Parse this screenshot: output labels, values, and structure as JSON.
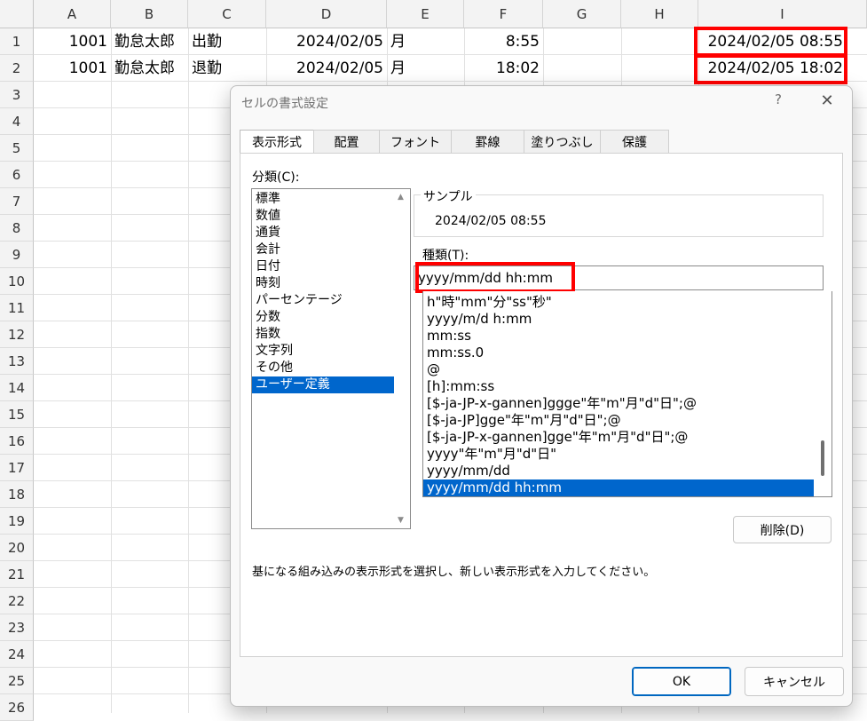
{
  "sheet": {
    "columns": [
      "A",
      "B",
      "C",
      "D",
      "E",
      "F",
      "G",
      "H",
      "I"
    ],
    "rows": [
      "1",
      "2",
      "3",
      "4",
      "5",
      "6",
      "7",
      "8",
      "9",
      "10",
      "11",
      "12",
      "13",
      "14",
      "15",
      "16",
      "17",
      "18",
      "19",
      "20",
      "21",
      "22",
      "23",
      "24",
      "25",
      "26"
    ],
    "data": [
      {
        "a": "1001",
        "b": "勤怠太郎",
        "c": "出勤",
        "d": "2024/02/05",
        "e": "月",
        "f": "8:55",
        "i": "2024/02/05 08:55"
      },
      {
        "a": "1001",
        "b": "勤怠太郎",
        "c": "退勤",
        "d": "2024/02/05",
        "e": "月",
        "f": "18:02",
        "i": "2024/02/05 18:02"
      }
    ],
    "highlight_color": "#ff0000"
  },
  "dialog": {
    "title": "セルの書式設定",
    "help": "?",
    "close": "✕",
    "tabs": [
      "表示形式",
      "配置",
      "フォント",
      "罫線",
      "塗りつぶし",
      "保護"
    ],
    "active_tab": "表示形式",
    "category_label": "分類(C):",
    "categories": [
      "標準",
      "数値",
      "通貨",
      "会計",
      "日付",
      "時刻",
      "パーセンテージ",
      "分数",
      "指数",
      "文字列",
      "その他",
      "ユーザー定義"
    ],
    "selected_category": "ユーザー定義",
    "sample_label": "サンプル",
    "sample_value": "2024/02/05 08:55",
    "type_label": "種類(T):",
    "type_value": "yyyy/mm/dd hh:mm",
    "formats": [
      "h\"時\"mm\"分\"ss\"秒\"",
      "yyyy/m/d h:mm",
      "mm:ss",
      "mm:ss.0",
      "@",
      "[h]:mm:ss",
      "[$-ja-JP-x-gannen]ggge\"年\"m\"月\"d\"日\";@",
      "[$-ja-JP]gge\"年\"m\"月\"d\"日\";@",
      "[$-ja-JP-x-gannen]gge\"年\"m\"月\"d\"日\";@",
      "yyyy\"年\"m\"月\"d\"日\"",
      "yyyy/mm/dd",
      "yyyy/mm/dd hh:mm"
    ],
    "selected_format": "yyyy/mm/dd hh:mm",
    "delete_button": "削除(D)",
    "description": "基になる組み込みの表示形式を選択し、新しい表示形式を入力してください。",
    "ok_button": "OK",
    "cancel_button": "キャンセル",
    "accent_color": "#0066cc"
  }
}
